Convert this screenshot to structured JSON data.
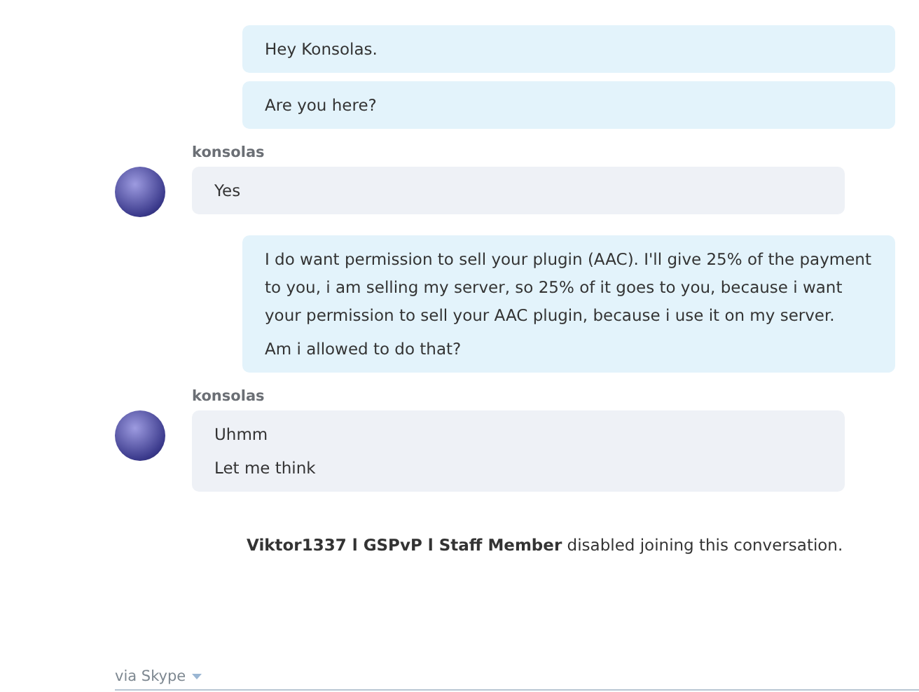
{
  "messages": [
    {
      "kind": "outgoing",
      "paragraphs": [
        "Hey Konsolas."
      ]
    },
    {
      "kind": "outgoing",
      "paragraphs": [
        "Are you here?"
      ]
    },
    {
      "kind": "incoming",
      "sender": "konsolas",
      "paragraphs": [
        "Yes"
      ]
    },
    {
      "kind": "outgoing",
      "paragraphs": [
        "I do want permission to sell your plugin (AAC). I'll give 25% of the payment to you, i am selling my server, so 25% of it goes to you, because i want your permission to sell your AAC plugin, because i use it on my server.",
        "Am i allowed to do that?"
      ]
    },
    {
      "kind": "incoming",
      "sender": "konsolas",
      "paragraphs": [
        "Uhmm",
        "Let me think"
      ]
    },
    {
      "kind": "notice",
      "text": "**Viktor1337 l GSPvP l Staff Member** disabled joining this conversation."
    }
  ],
  "footer": {
    "label": "via Skype"
  }
}
